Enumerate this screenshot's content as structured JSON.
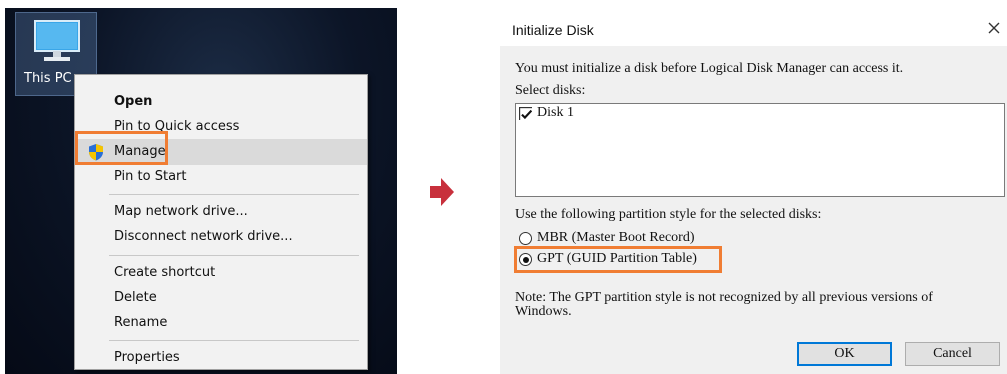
{
  "desktop": {
    "icon_label": "This PC",
    "context_menu": {
      "items": [
        {
          "label": "Open"
        },
        {
          "label": "Pin to Quick access"
        },
        {
          "label": "Manage"
        },
        {
          "label": "Pin to Start"
        },
        {
          "label": "Map network drive..."
        },
        {
          "label": "Disconnect network drive..."
        },
        {
          "label": "Create shortcut"
        },
        {
          "label": "Delete"
        },
        {
          "label": "Rename"
        },
        {
          "label": "Properties"
        }
      ]
    }
  },
  "dialog": {
    "title": "Initialize Disk",
    "intro": "You must initialize a disk before Logical Disk Manager can access it.",
    "select_label": "Select disks:",
    "disks": [
      {
        "label": "Disk 1",
        "checked": true
      }
    ],
    "partition_label": "Use the following partition style for the selected disks:",
    "options": [
      {
        "label": "MBR (Master Boot Record)",
        "selected": false
      },
      {
        "label": "GPT (GUID Partition Table)",
        "selected": true
      }
    ],
    "note_line1": "Note: The GPT partition style is not recognized by all previous versions of",
    "note_line2": "Windows.",
    "ok_label": "OK",
    "cancel_label": "Cancel"
  },
  "colors": {
    "highlight": "#f07d33",
    "arrow": "#c8303c",
    "default_button_border": "#0078d7"
  },
  "icons": [
    "this-pc-icon",
    "shield-icon",
    "arrow-right-icon",
    "close-icon",
    "checkbox-checked-icon"
  ]
}
